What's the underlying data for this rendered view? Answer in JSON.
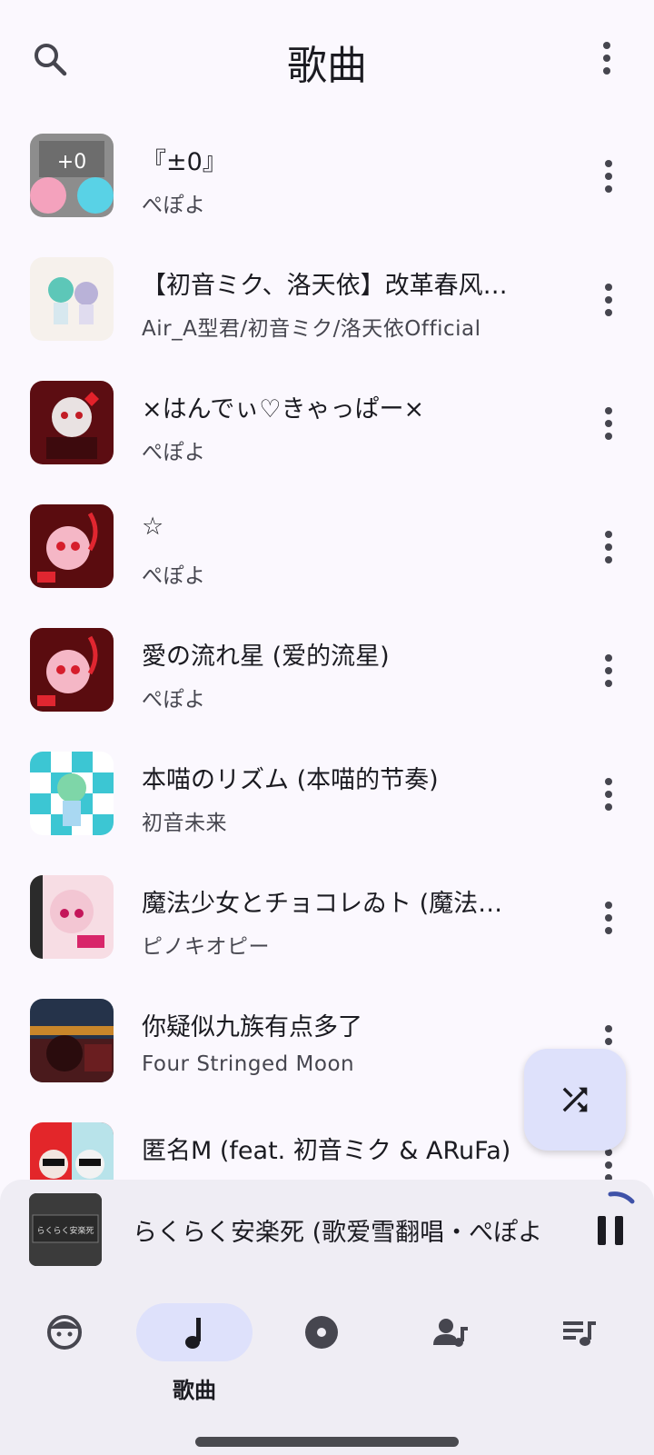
{
  "header": {
    "title": "歌曲",
    "search_icon": "search-icon",
    "more_icon": "more-vert-icon"
  },
  "songs": [
    {
      "title": "『±0』",
      "artist": "ぺぽよ",
      "cover_color": "#8a8a8a"
    },
    {
      "title": "【初音ミク、洛天依】改革春风…",
      "artist": "Air_A型君/初音ミク/洛天依Official",
      "cover_color": "#f3efe9"
    },
    {
      "title": "×はんでぃ♡きゃっぱー×",
      "artist": "ぺぽよ",
      "cover_color": "#7a1116"
    },
    {
      "title": "☆",
      "artist": "ぺぽよ",
      "cover_color": "#6a0f12"
    },
    {
      "title": "愛の流れ星 (爱的流星)",
      "artist": "ぺぽよ",
      "cover_color": "#6a0f12"
    },
    {
      "title": "本喵のリズム (本喵的节奏)",
      "artist": "初音未来",
      "cover_color": "#3cc6d3"
    },
    {
      "title": "魔法少女とチョコレゐト (魔法…",
      "artist": "ピノキオピー",
      "cover_color": "#f5d7df"
    },
    {
      "title": "你疑似九族有点多了",
      "artist": "Four Stringed Moon",
      "cover_color": "#2a3446"
    },
    {
      "title": "匿名M (feat. 初音ミク & ARuFa)",
      "artist": "",
      "cover_color": "#e3262a"
    }
  ],
  "shuffle_fab": {
    "icon": "shuffle-icon"
  },
  "mini_player": {
    "title": "らくらく安楽死 (歌爱雪翻唱・ぺぽよ",
    "cover_text": "らくらく安楽死",
    "pause_icon": "pause-icon"
  },
  "bottom_nav": {
    "items": [
      {
        "icon": "face-icon",
        "label": ""
      },
      {
        "icon": "music-note-icon",
        "label": "歌曲",
        "active": true
      },
      {
        "icon": "album-icon",
        "label": ""
      },
      {
        "icon": "artist-icon",
        "label": ""
      },
      {
        "icon": "playlist-icon",
        "label": ""
      }
    ]
  },
  "colors": {
    "background": "#fbf8fe",
    "accent_container": "#dee1fb",
    "surface_container": "#efedf4",
    "on_surface": "#1b1b21",
    "on_surface_variant": "#46464f"
  }
}
